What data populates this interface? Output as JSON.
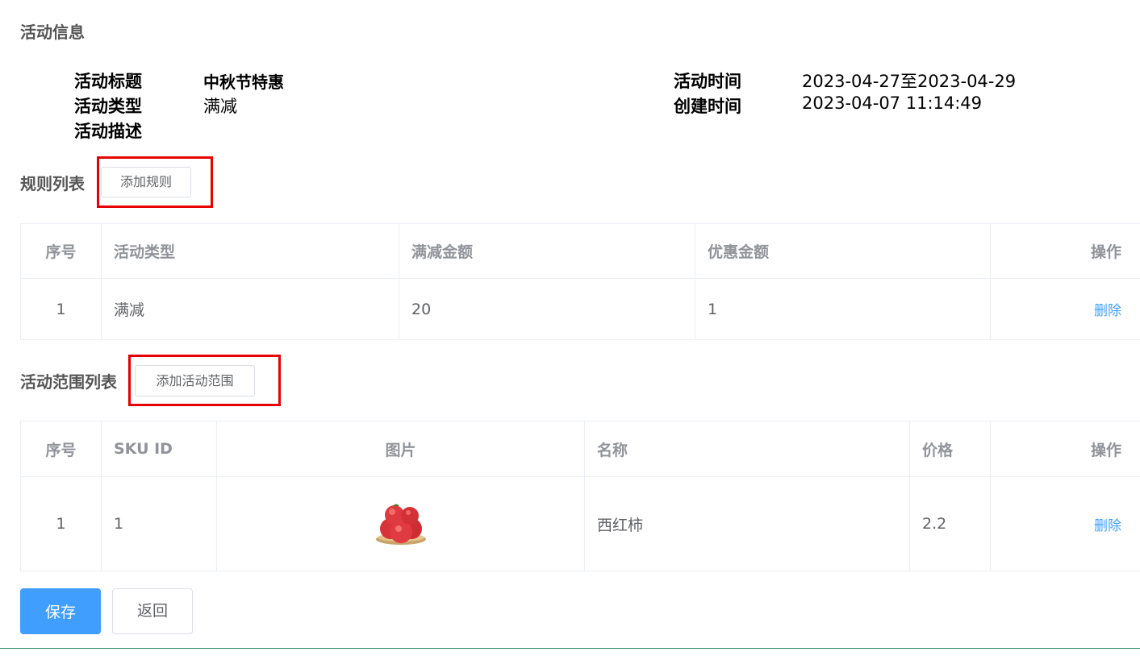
{
  "activity_info": {
    "section_title": "活动信息",
    "labels": {
      "title": "活动标题",
      "type": "活动类型",
      "description": "活动描述",
      "time": "活动时间",
      "created": "创建时间"
    },
    "values": {
      "title": "中秋节特惠",
      "type": "满减",
      "description": "",
      "time": "2023-04-27至2023-04-29",
      "created": "2023-04-07 11:14:49"
    }
  },
  "rules": {
    "section_title": "规则列表",
    "add_button": "添加规则",
    "headers": [
      "序号",
      "活动类型",
      "满减金额",
      "优惠金额",
      "操作"
    ],
    "rows": [
      {
        "index": "1",
        "type": "满减",
        "condition_amount": "20",
        "benefit_amount": "1",
        "action": "删除"
      }
    ]
  },
  "scope": {
    "section_title": "活动范围列表",
    "add_button": "添加活动范围",
    "headers": [
      "序号",
      "SKU ID",
      "图片",
      "名称",
      "价格",
      "操作"
    ],
    "rows": [
      {
        "index": "1",
        "sku_id": "1",
        "image": "tomato-image",
        "name": "西红柿",
        "price": "2.2",
        "action": "删除"
      }
    ]
  },
  "footer": {
    "save_button": "保存",
    "back_button": "返回"
  },
  "colors": {
    "primary": "#409eff",
    "highlight_box": "#e60000",
    "link": "#409eff"
  }
}
